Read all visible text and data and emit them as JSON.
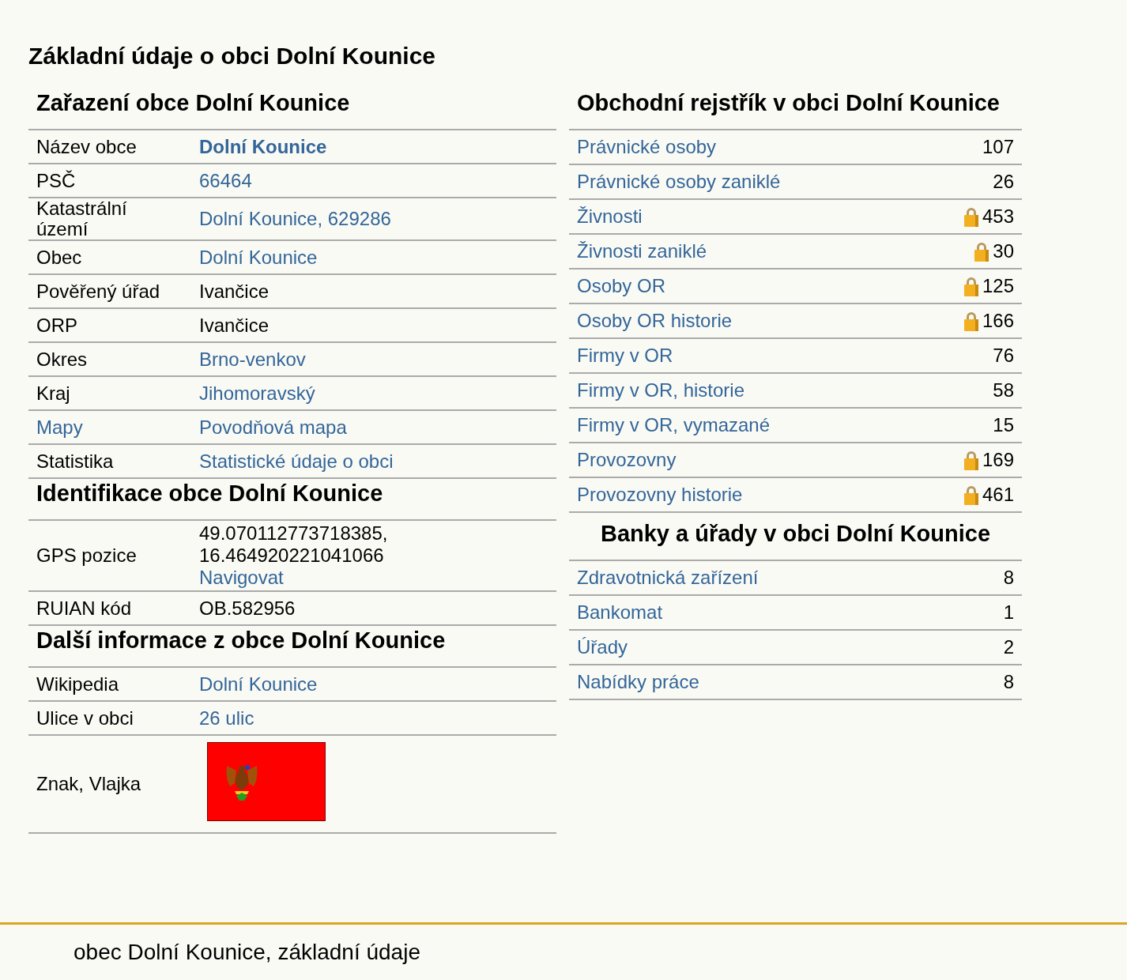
{
  "title": "Základní údaje o obci Dolní Kounice",
  "left_sections": [
    {
      "heading": "Zařazení obce Dolní Kounice",
      "rows": [
        {
          "label": {
            "text": "Název obce",
            "kind": "text"
          },
          "values": [
            {
              "text": "Dolní Kounice",
              "kind": "bold-link"
            }
          ]
        },
        {
          "label": {
            "text": "PSČ",
            "kind": "text"
          },
          "values": [
            {
              "text": "66464",
              "kind": "link"
            }
          ]
        },
        {
          "label": {
            "text": "Katastrální území",
            "kind": "text"
          },
          "values": [
            {
              "text": "Dolní Kounice, 629286",
              "kind": "link"
            }
          ]
        },
        {
          "label": {
            "text": "Obec",
            "kind": "text"
          },
          "values": [
            {
              "text": "Dolní Kounice",
              "kind": "link"
            }
          ]
        },
        {
          "label": {
            "text": "Pověřený úřad",
            "kind": "text"
          },
          "values": [
            {
              "text": "Ivančice",
              "kind": "text"
            }
          ]
        },
        {
          "label": {
            "text": "ORP",
            "kind": "text"
          },
          "values": [
            {
              "text": "Ivančice",
              "kind": "text"
            }
          ]
        },
        {
          "label": {
            "text": "Okres",
            "kind": "text"
          },
          "values": [
            {
              "text": "Brno-venkov",
              "kind": "link"
            }
          ]
        },
        {
          "label": {
            "text": "Kraj",
            "kind": "text"
          },
          "values": [
            {
              "text": "Jihomoravský",
              "kind": "link"
            }
          ]
        },
        {
          "label": {
            "text": "Mapy",
            "kind": "link"
          },
          "values": [
            {
              "text": "Povodňová mapa",
              "kind": "link"
            }
          ]
        },
        {
          "label": {
            "text": "Statistika",
            "kind": "text"
          },
          "values": [
            {
              "text": "Statistické údaje o obci",
              "kind": "link"
            }
          ]
        }
      ]
    },
    {
      "heading": "Identifikace obce Dolní Kounice",
      "rows": [
        {
          "label": {
            "text": "GPS pozice",
            "kind": "text"
          },
          "values": [
            {
              "text": "49.070112773718385,",
              "kind": "text"
            },
            {
              "text": "16.464920221041066",
              "kind": "text"
            },
            {
              "text": "Navigovat",
              "kind": "link"
            }
          ]
        },
        {
          "label": {
            "text": "RUIAN kód",
            "kind": "text"
          },
          "values": [
            {
              "text": "OB.582956",
              "kind": "text"
            }
          ]
        }
      ]
    },
    {
      "heading": "Další informace z obce Dolní Kounice",
      "rows": [
        {
          "label": {
            "text": "Wikipedia",
            "kind": "text"
          },
          "values": [
            {
              "text": "Dolní Kounice",
              "kind": "link"
            }
          ]
        },
        {
          "label": {
            "text": "Ulice v obci",
            "kind": "text"
          },
          "values": [
            {
              "text": "26 ulic",
              "kind": "link"
            }
          ]
        },
        {
          "label": {
            "text": "Znak, Vlajka",
            "kind": "text"
          },
          "values": [
            {
              "kind": "flag"
            }
          ]
        }
      ]
    }
  ],
  "right_sections": [
    {
      "heading": "Obchodní rejstřík v obci Dolní Kounice",
      "centered": false,
      "rows": [
        {
          "name": "Právnické osoby",
          "count": "107",
          "locked": false
        },
        {
          "name": "Právnické osoby zaniklé",
          "count": "26",
          "locked": false
        },
        {
          "name": "Živnosti",
          "count": "453",
          "locked": true
        },
        {
          "name": "Živnosti zaniklé",
          "count": "30",
          "locked": true
        },
        {
          "name": "Osoby OR",
          "count": "125",
          "locked": true
        },
        {
          "name": "Osoby OR historie",
          "count": "166",
          "locked": true
        },
        {
          "name": "Firmy v OR",
          "count": "76",
          "locked": false
        },
        {
          "name": "Firmy v OR, historie",
          "count": "58",
          "locked": false
        },
        {
          "name": "Firmy v OR, vymazané",
          "count": "15",
          "locked": false
        },
        {
          "name": "Provozovny",
          "count": "169",
          "locked": true
        },
        {
          "name": "Provozovny historie",
          "count": "461",
          "locked": true
        }
      ]
    },
    {
      "heading": "Banky a úřady v obci Dolní Kounice",
      "centered": true,
      "rows": [
        {
          "name": "Zdravotnická zařízení",
          "count": "8",
          "locked": false
        },
        {
          "name": "Bankomat",
          "count": "1",
          "locked": false
        },
        {
          "name": "Úřady",
          "count": "2",
          "locked": false
        },
        {
          "name": "Nabídky práce",
          "count": "8",
          "locked": false
        }
      ]
    }
  ],
  "footer": "obec Dolní Kounice, základní údaje"
}
